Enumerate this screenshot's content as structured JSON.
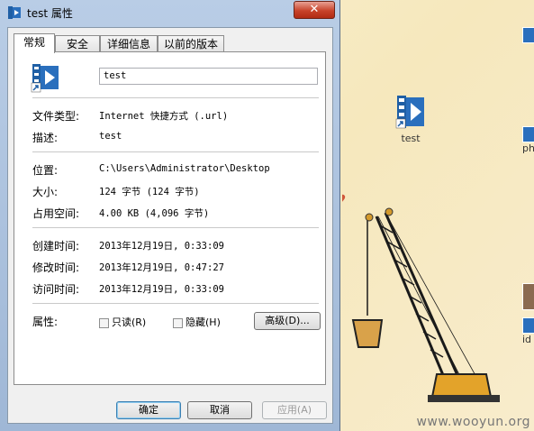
{
  "window": {
    "title": "test 属性",
    "close_glyph": "✕",
    "tabs": [
      {
        "label": "常规",
        "active": true
      },
      {
        "label": "安全",
        "active": false
      },
      {
        "label": "详细信息",
        "active": false
      },
      {
        "label": "以前的版本",
        "active": false
      }
    ],
    "file_name": "test",
    "rows": {
      "type_label": "文件类型:",
      "type_value": "Internet 快捷方式 (.url)",
      "desc_label": "描述:",
      "desc_value": "test",
      "location_label": "位置:",
      "location_value": "C:\\Users\\Administrator\\Desktop",
      "size_label": "大小:",
      "size_value": "124 字节 (124 字节)",
      "disk_label": "占用空间:",
      "disk_value": "4.00 KB (4,096 字节)",
      "created_label": "创建时间:",
      "created_value": "2013年12月19日, 0:33:09",
      "modified_label": "修改时间:",
      "modified_value": "2013年12月19日, 0:47:27",
      "accessed_label": "访问时间:",
      "accessed_value": "2013年12月19日, 0:33:09",
      "attr_label": "属性:"
    },
    "attributes": {
      "readonly_label": "只读(R)",
      "readonly_checked": false,
      "hidden_label": "隐藏(H)",
      "hidden_checked": false,
      "advanced_label": "高级(D)..."
    },
    "buttons": {
      "ok": "确定",
      "cancel": "取消",
      "apply": "应用(A)"
    }
  },
  "desktop": {
    "icon_label": "test",
    "partial_label_1": "ph",
    "partial_label_2": "id",
    "watermark": "www.wooyun.org"
  },
  "colors": {
    "accent": "#2a6fbd",
    "title_bg": "#b9cde6"
  }
}
